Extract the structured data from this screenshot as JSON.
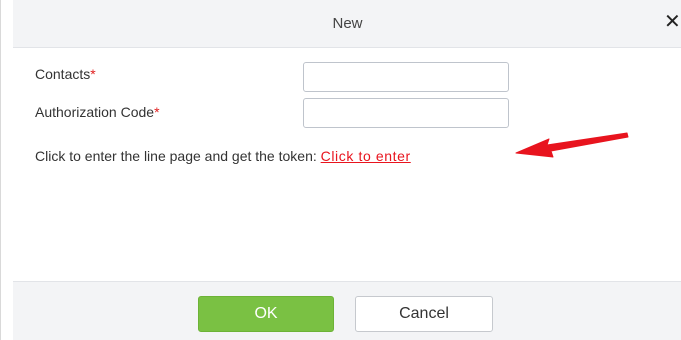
{
  "dialog": {
    "title": "New",
    "close_glyph": "✕"
  },
  "form": {
    "contacts": {
      "label": "Contacts",
      "required_mark": "*",
      "value": ""
    },
    "authorization_code": {
      "label": "Authorization Code",
      "required_mark": "*",
      "value": ""
    },
    "hint_text": "Click to enter the line page and get the token: ",
    "hint_link": "Click to enter"
  },
  "annotation": {
    "arrow_color": "#e8141e"
  },
  "footer": {
    "ok_label": "OK",
    "cancel_label": "Cancel"
  },
  "colors": {
    "ok_button": "#7ac143",
    "link": "#e8141e",
    "required": "#e02020"
  }
}
